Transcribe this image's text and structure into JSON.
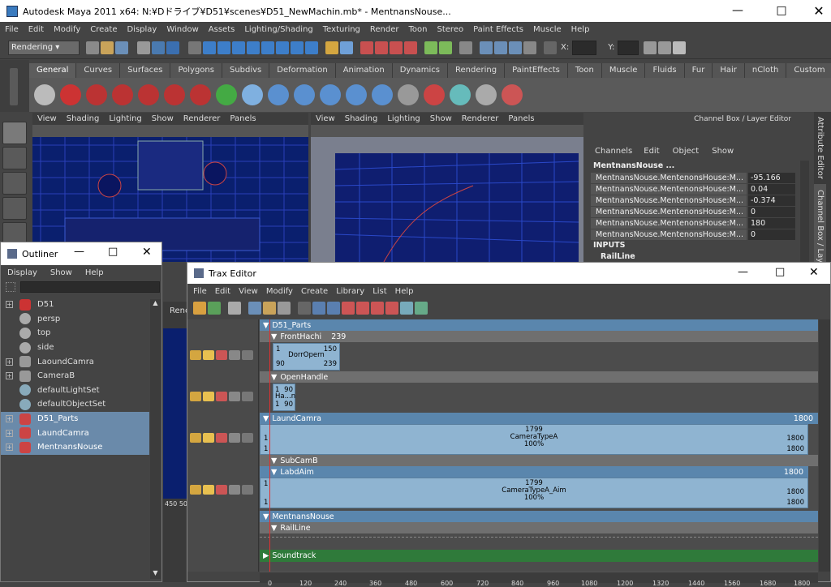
{
  "window": {
    "title": "Autodesk Maya 2011 x64: N:¥Dドライブ¥D51¥scenes¥D51_NewMachin.mb*   -   MentnansNouse..."
  },
  "main_menu": [
    "File",
    "Edit",
    "Modify",
    "Create",
    "Display",
    "Window",
    "Assets",
    "Lighting/Shading",
    "Texturing",
    "Render",
    "Toon",
    "Stereo",
    "Paint Effects",
    "Muscle",
    "Help"
  ],
  "status_line": {
    "mode": "Rendering",
    "x_label": "X:",
    "y_label": "Y:"
  },
  "shelf_tabs": [
    "General",
    "Curves",
    "Surfaces",
    "Polygons",
    "Subdivs",
    "Deformation",
    "Animation",
    "Dynamics",
    "Rendering",
    "PaintEffects",
    "Toon",
    "Muscle",
    "Fluids",
    "Fur",
    "Hair",
    "nCloth",
    "Custom"
  ],
  "shelf_active": "General",
  "viewport_menu": [
    "View",
    "Shading",
    "Lighting",
    "Show",
    "Renderer",
    "Panels"
  ],
  "channel_box": {
    "title": "Channel Box / Layer Editor",
    "menu": [
      "Channels",
      "Edit",
      "Object",
      "Show"
    ],
    "object": "MentnansNouse ...",
    "rows": [
      {
        "name": "MentnansNouse.MentenonsHouse:M...",
        "value": "-95.166"
      },
      {
        "name": "MentnansNouse.MentenonsHouse:M...",
        "value": "0.04"
      },
      {
        "name": "MentnansNouse.MentenonsHouse:M...",
        "value": "-0.374"
      },
      {
        "name": "MentnansNouse.MentenonsHouse:M...",
        "value": "0"
      },
      {
        "name": "MentnansNouse.MentenonsHouse:M...",
        "value": "180"
      },
      {
        "name": "MentnansNouse.MentenonsHouse:M...",
        "value": "0"
      }
    ],
    "inputs_label": "INPUTS",
    "input_item": "RailLine"
  },
  "side_tabs": [
    "Attribute Editor",
    "Channel Box / Layer"
  ],
  "outliner": {
    "title": "Outliner",
    "menu": [
      "Display",
      "Show",
      "Help"
    ],
    "items": [
      {
        "label": "D51",
        "expand": true,
        "selected": false,
        "icon": "mesh-icon"
      },
      {
        "label": "persp",
        "expand": false,
        "selected": false,
        "icon": "camera-icon"
      },
      {
        "label": "top",
        "expand": false,
        "selected": false,
        "icon": "camera-icon"
      },
      {
        "label": "side",
        "expand": false,
        "selected": false,
        "icon": "camera-icon"
      },
      {
        "label": "LaoundCamra",
        "expand": true,
        "selected": false,
        "icon": "camera-icon"
      },
      {
        "label": "CameraB",
        "expand": true,
        "selected": false,
        "icon": "camera-icon"
      },
      {
        "label": "defaultLightSet",
        "expand": false,
        "selected": false,
        "icon": "set-icon"
      },
      {
        "label": "defaultObjectSet",
        "expand": false,
        "selected": false,
        "icon": "set-icon"
      },
      {
        "label": "D51_Parts",
        "expand": true,
        "selected": true,
        "icon": "character-icon"
      },
      {
        "label": "LaundCamra",
        "expand": true,
        "selected": true,
        "icon": "character-icon"
      },
      {
        "label": "MentnansNouse",
        "expand": true,
        "selected": true,
        "icon": "character-icon"
      }
    ]
  },
  "bg_labels": {
    "render_tab": "Renc",
    "time_label": "450 50"
  },
  "trax": {
    "title": "Trax Editor",
    "menu": [
      "File",
      "Edit",
      "View",
      "Modify",
      "Create",
      "Library",
      "List",
      "Help"
    ],
    "groups": [
      {
        "name": "D51_Parts"
      },
      {
        "name": "FrontHachi",
        "end": "239"
      },
      {
        "name": "OpenHandle"
      },
      {
        "name": "LaundCamra",
        "end": "1800"
      },
      {
        "name": "SubCamB"
      },
      {
        "name": "LabdAim",
        "end": "1800"
      },
      {
        "name": "MentnansNouse"
      },
      {
        "name": "RailLine"
      },
      {
        "name": "Soundtrack"
      }
    ],
    "clips": [
      {
        "name": "DorrOpern",
        "tl": "1",
        "tr": "150",
        "bl": "90",
        "br": "239"
      },
      {
        "name": "Ha...n",
        "tl": "1",
        "tr": "90",
        "bl": "1",
        "br": "90"
      },
      {
        "name": "CameraTypeA",
        "weight": "100%",
        "top": "1799",
        "left": "1",
        "right": "1800",
        "bl": "1",
        "br": "1800"
      },
      {
        "name": "CameraTypeA_Aim",
        "weight": "100%",
        "top": "1799",
        "left": "1",
        "right": "1800",
        "bl": "1",
        "br": "1800"
      }
    ],
    "ruler": [
      "0",
      "120",
      "240",
      "360",
      "480",
      "600",
      "720",
      "840",
      "960",
      "1080",
      "1200",
      "1320",
      "1440",
      "1560",
      "1680",
      "1800"
    ]
  }
}
